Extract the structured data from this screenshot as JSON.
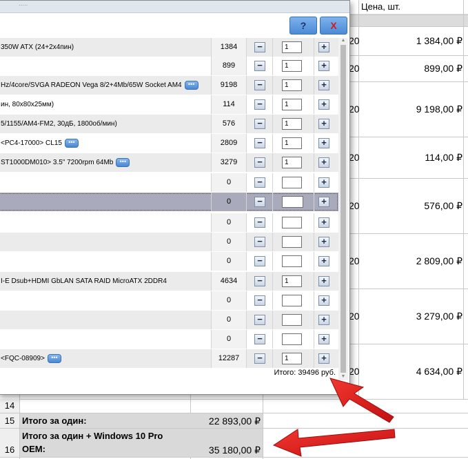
{
  "sheet": {
    "header_col_label": "Цена, шт.",
    "prices": [
      "1 384,00 ₽",
      "899,00 ₽",
      "9 198,00 ₽",
      "114,00 ₽",
      "576,00 ₽",
      "2 809,00 ₽",
      "3 279,00 ₽",
      "4 634,00 ₽"
    ],
    "qty_fragment": "20",
    "row_numbers": [
      "14",
      "15",
      "16"
    ],
    "total_one_label": "Итого за один:",
    "total_one_value": "22 893,00 ₽",
    "total_win_label_line1": "Итого за один + Windows 10 Pro",
    "total_win_label_line2": "OEM:",
    "total_win_value": "35 180,00 ₽"
  },
  "dialog": {
    "title_grip": "·····",
    "help_label": "?",
    "close_label": "X",
    "more_label": "•••",
    "minus": "−",
    "plus": "+",
    "total_text": "Итого: 39496 руб.",
    "rows": [
      {
        "name": "350W ATX (24+2x4пин)",
        "price": "1384",
        "qty": "1",
        "more": false
      },
      {
        "name": "",
        "price": "899",
        "qty": "1",
        "more": false
      },
      {
        "name": "Hz/4core/SVGA RADEON Vega 8/2+4Mb/65W Socket AM4",
        "price": "9198",
        "qty": "1",
        "more": true
      },
      {
        "name": "ин, 80x80x25мм)",
        "price": "114",
        "qty": "1",
        "more": false
      },
      {
        "name": "5/1155/AM4-FM2, 30дБ, 1800об/мин)",
        "price": "576",
        "qty": "1",
        "more": false
      },
      {
        "name": "<PC4-17000> CL15",
        "price": "2809",
        "qty": "1",
        "more": true
      },
      {
        "name": "ST1000DM010> 3.5\" 7200rpm 64Mb",
        "price": "3279",
        "qty": "1",
        "more": true
      },
      {
        "name": "",
        "price": "0",
        "qty": "",
        "more": false
      },
      {
        "name": "",
        "price": "0",
        "qty": "",
        "more": false
      },
      {
        "name": "",
        "price": "0",
        "qty": "",
        "more": false
      },
      {
        "name": "",
        "price": "0",
        "qty": "",
        "more": false
      },
      {
        "name": "",
        "price": "0",
        "qty": "",
        "more": false
      },
      {
        "name": "I-E Dsub+HDMI GbLAN SATA RAID MicroATX 2DDR4",
        "price": "4634",
        "qty": "1",
        "more": false
      },
      {
        "name": "",
        "price": "0",
        "qty": "",
        "more": false
      },
      {
        "name": "",
        "price": "0",
        "qty": "",
        "more": false
      },
      {
        "name": "",
        "price": "0",
        "qty": "",
        "more": false
      },
      {
        "name": "<FQC-08909>",
        "price": "12287",
        "qty": "1",
        "more": true
      }
    ]
  },
  "colors": {
    "arrow": "#e0191b",
    "button_blue": "#4b8ad6",
    "selected_row": "#a9abbc"
  }
}
